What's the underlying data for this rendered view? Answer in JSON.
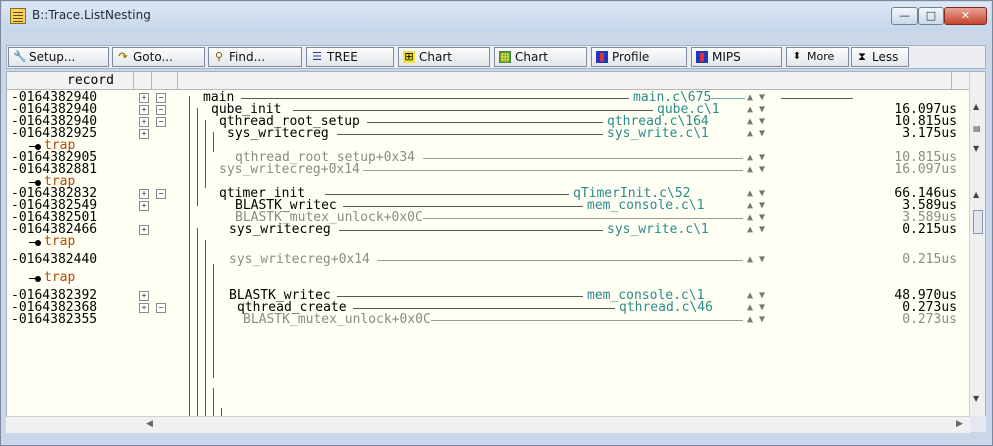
{
  "window": {
    "title": "B::Trace.ListNesting"
  },
  "window_controls": {
    "minimize": "—",
    "maximize": "□",
    "close": "✕"
  },
  "toolbar": {
    "setup": "Setup...",
    "goto": "Goto...",
    "find": "Find...",
    "tree": "TREE",
    "chart1": "Chart",
    "chart2": "Chart",
    "profile": "Profile",
    "mips": "MIPS",
    "more": "More",
    "less": "Less"
  },
  "list": {
    "column_header": "record",
    "rows": [
      {
        "record": "-0164382940",
        "name": "main",
        "source": "main.c\\675",
        "time": ""
      },
      {
        "record": "-0164382940",
        "name": "qube_init",
        "source": "qube.c\\1",
        "time": "16.097us"
      },
      {
        "record": "-0164382940",
        "name": "qthread_root_setup",
        "source": "qthread.c\\164",
        "time": "10.815us"
      },
      {
        "record": "-0164382925",
        "name": "sys_writecreg",
        "source": "sys_write.c\\1",
        "time": "3.175us"
      },
      {
        "record": "",
        "name": "trap",
        "source": "",
        "time": ""
      },
      {
        "record": "-0164382905",
        "name": "qthread_root_setup+0x34",
        "source": "",
        "time": "10.815us"
      },
      {
        "record": "-0164382881",
        "name": "sys_writecreg+0x14",
        "source": "",
        "time": "16.097us"
      },
      {
        "record": "",
        "name": "trap",
        "source": "",
        "time": ""
      },
      {
        "record": "-0164382832",
        "name": "qtimer_init",
        "source": "qTimerInit.c\\52",
        "time": "66.146us"
      },
      {
        "record": "-0164382549",
        "name": "BLASTK_writec",
        "source": "mem_console.c\\1",
        "time": "3.589us"
      },
      {
        "record": "-0164382501",
        "name": "BLASTK_mutex_unlock+0x0C",
        "source": "",
        "time": "3.589us"
      },
      {
        "record": "-0164382466",
        "name": "sys_writecreg",
        "source": "sys_write.c\\1",
        "time": "0.215us"
      },
      {
        "record": "",
        "name": "trap",
        "source": "",
        "time": ""
      },
      {
        "record": "-0164382440",
        "name": "sys_writecreg+0x14",
        "source": "",
        "time": "0.215us"
      },
      {
        "record": "",
        "name": "trap",
        "source": "",
        "time": ""
      },
      {
        "record": "-0164382392",
        "name": "BLASTK_writec",
        "source": "mem_console.c\\1",
        "time": "48.970us"
      },
      {
        "record": "-0164382368",
        "name": "qthread_create",
        "source": "qthread.c\\46",
        "time": "0.273us"
      },
      {
        "record": "-0164382355",
        "name": "BLASTK_mutex_unlock+0x0C",
        "source": "",
        "time": "0.273us"
      }
    ]
  },
  "icons": {
    "setup": "wrench-icon",
    "goto": "goto-icon",
    "find": "binoculars-icon",
    "tree": "tree-icon",
    "chart1": "chart-icon",
    "chart2": "chart-table-icon",
    "profile": "profile-icon",
    "mips": "mips-icon",
    "more": "updown-arrow-icon",
    "less": "hourglass-icon"
  },
  "colors": {
    "source_text": "#2d8a8a",
    "trap_text": "#b44a00",
    "list_background": "#fffff4"
  }
}
